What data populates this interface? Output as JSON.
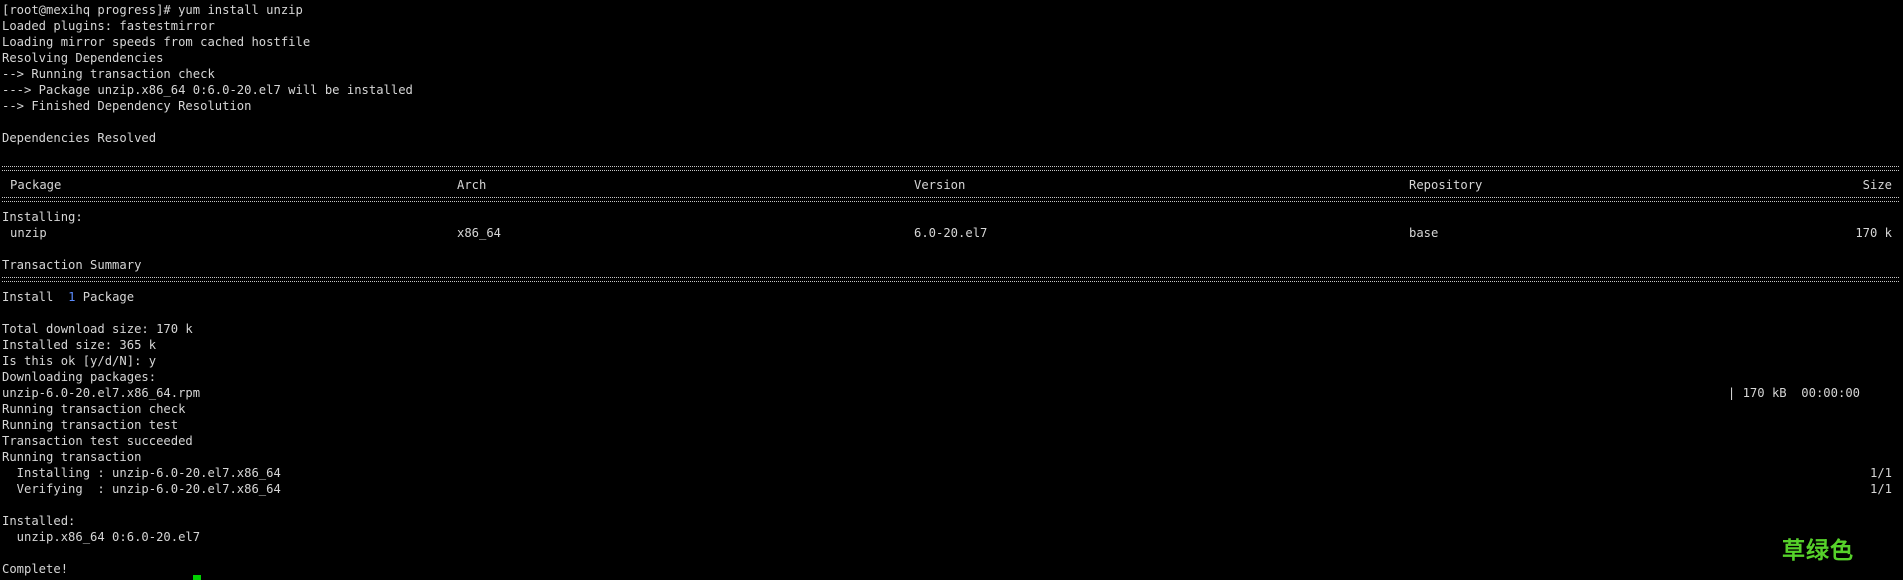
{
  "terminal": {
    "prompt_line": "[root@mexihq progress]# yum install unzip",
    "pre_lines": [
      "Loaded plugins: fastestmirror",
      "Loading mirror speeds from cached hostfile",
      "Resolving Dependencies",
      "--> Running transaction check",
      "---> Package unzip.x86_64 0:6.0-20.el7 will be installed",
      "--> Finished Dependency Resolution",
      "Dependencies Resolved"
    ],
    "table": {
      "headers": {
        "package": "Package",
        "arch": "Arch",
        "version": "Version",
        "repository": "Repository",
        "size": "Size"
      },
      "section_label": "Installing:",
      "row": {
        "package": "unzip",
        "arch": "x86_64",
        "version": "6.0-20.el7",
        "repository": "base",
        "size": "170 k"
      }
    },
    "summary": {
      "title": "Transaction Summary",
      "install_prefix": "Install",
      "install_count": "1",
      "install_suffix": "Package"
    },
    "post_lines": [
      "Total download size: 170 k",
      "Installed size: 365 k",
      "Is this ok [y/d/N]: y",
      "Downloading packages:"
    ],
    "download": {
      "file": "unzip-6.0-20.el7.x86_64.rpm",
      "progress": "| 170 kB  00:00:00"
    },
    "transaction_lines": [
      "Running transaction check",
      "Running transaction test",
      "Transaction test succeeded",
      "Running transaction"
    ],
    "steps": [
      {
        "label": "  Installing : unzip-6.0-20.el7.x86_64",
        "count": "1/1"
      },
      {
        "label": "  Verifying  : unzip-6.0-20.el7.x86_64",
        "count": "1/1"
      }
    ],
    "installed_label": "Installed:",
    "installed_item": "  unzip.x86_64 0:6.0-20.el7",
    "complete": "Complete!"
  },
  "watermark": "草绿色",
  "colors": {
    "background": "#000000",
    "text": "#d6d6d6",
    "accent_blue": "#5b8cff",
    "cursor": "#00d000",
    "watermark": "#56d12a"
  }
}
